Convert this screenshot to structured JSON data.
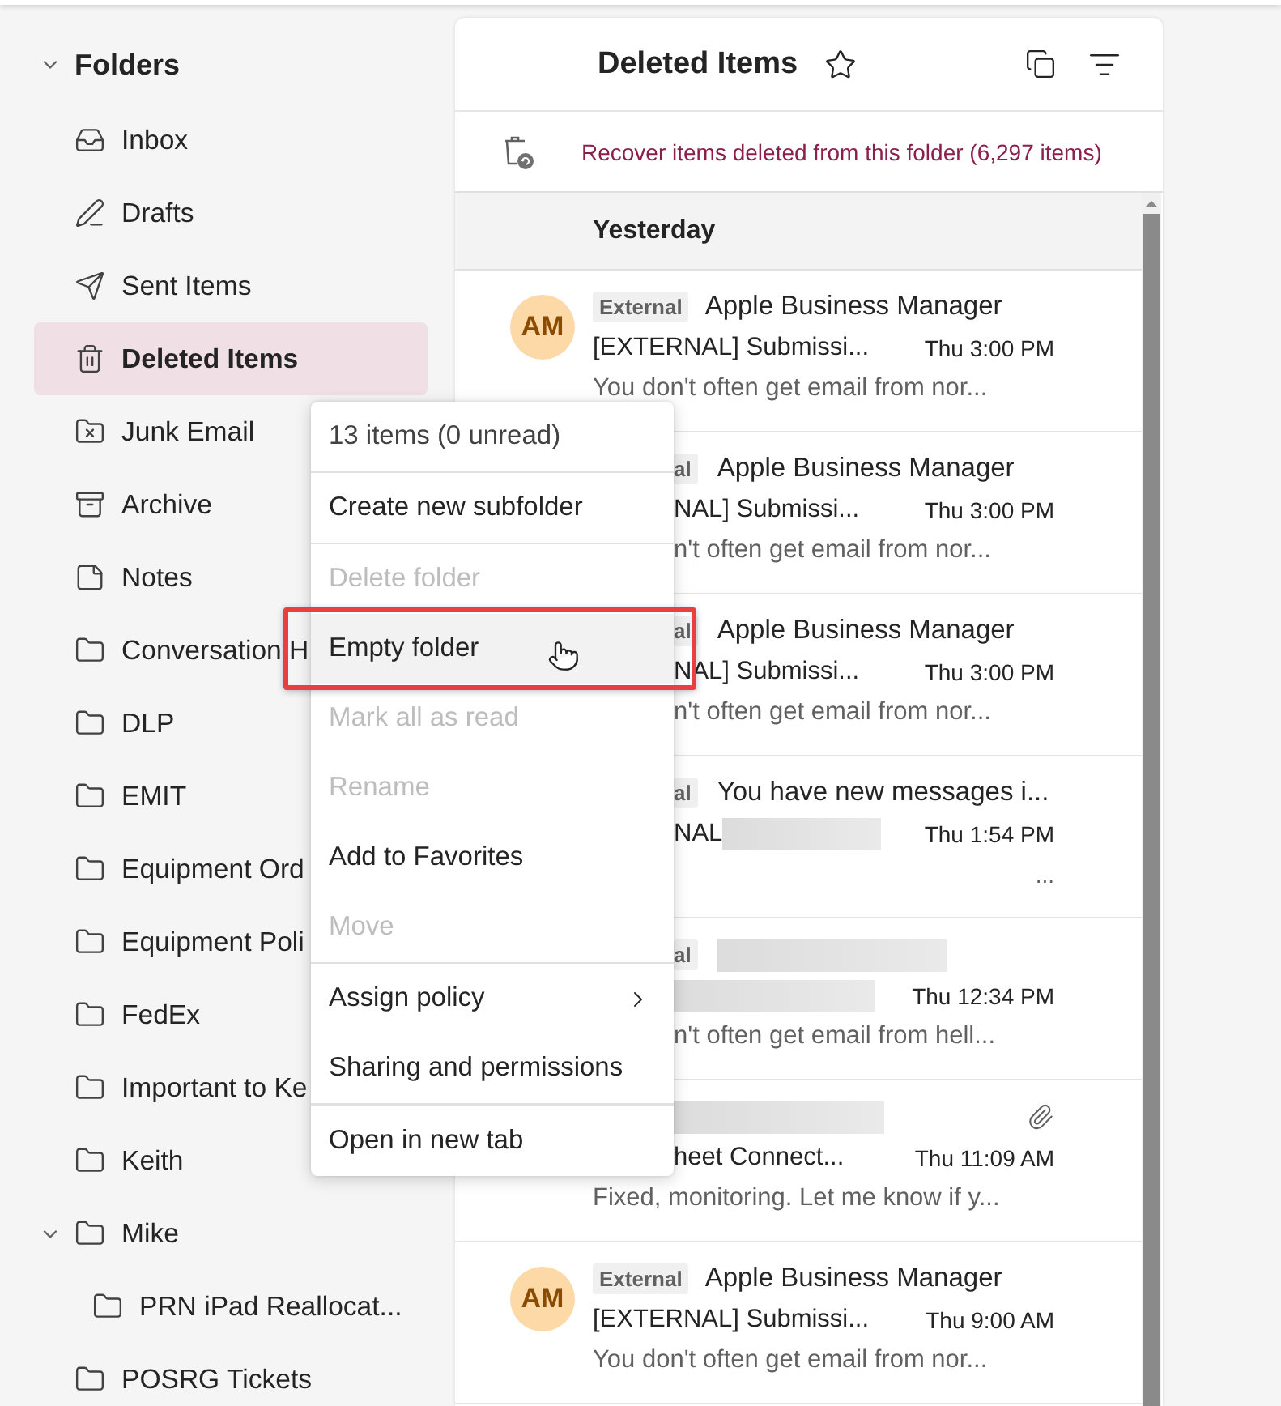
{
  "sidebar": {
    "header": {
      "label": "Folders",
      "expanded": true
    },
    "folders": [
      {
        "label": "Inbox",
        "kind": "inbox",
        "selected": false
      },
      {
        "label": "Drafts",
        "kind": "drafts",
        "selected": false
      },
      {
        "label": "Sent Items",
        "kind": "sent",
        "selected": false
      },
      {
        "label": "Deleted Items",
        "kind": "deleted",
        "selected": true
      },
      {
        "label": "Junk Email",
        "kind": "junk",
        "selected": false
      },
      {
        "label": "Archive",
        "kind": "archive",
        "selected": false
      },
      {
        "label": "Notes",
        "kind": "notes",
        "selected": false
      },
      {
        "label": "Conversation H",
        "kind": "folder",
        "selected": false
      },
      {
        "label": "DLP",
        "kind": "folder",
        "selected": false
      },
      {
        "label": "EMIT",
        "kind": "folder",
        "selected": false
      },
      {
        "label": "Equipment Ord",
        "kind": "folder",
        "selected": false
      },
      {
        "label": "Equipment Poli",
        "kind": "folder",
        "selected": false
      },
      {
        "label": "FedEx",
        "kind": "folder",
        "selected": false
      },
      {
        "label": "Important to Ke",
        "kind": "folder",
        "selected": false
      },
      {
        "label": "Keith",
        "kind": "folder",
        "selected": false
      },
      {
        "label": "Mike",
        "kind": "folder",
        "selected": false,
        "expanded": true,
        "children": [
          {
            "label": "PRN iPad Reallocat...",
            "kind": "folder",
            "selected": false
          }
        ]
      },
      {
        "label": "POSRG Tickets",
        "kind": "folder",
        "selected": false
      }
    ]
  },
  "message_list": {
    "title": "Deleted Items",
    "recover_link": "Recover items deleted from this folder (6,297 items)",
    "group": "Yesterday",
    "messages": [
      {
        "avatar": "AM",
        "tag": "External",
        "sender": "Apple Business Manager",
        "subject": "[EXTERNAL] Submissi...",
        "time": "Thu 3:00 PM",
        "preview": "You don't often get email from nor...",
        "covered": false,
        "preview_covered": false
      },
      {
        "tag": "al",
        "sender": "Apple Business Manager",
        "subject": "NAL] Submissi...",
        "time": "Thu 3:00 PM",
        "preview": "n't often get email from nor...",
        "covered": true,
        "preview_covered": true
      },
      {
        "tag": "al",
        "sender": "Apple Business Manager",
        "subject": "NAL] Submissi...",
        "time": "Thu 3:00 PM",
        "preview": "n't often get email from nor...",
        "covered": true,
        "preview_covered": true
      },
      {
        "tag": "al",
        "sender": "You have new messages i...",
        "subject": "NAL",
        "subject_redacted": true,
        "time": "Thu 1:54 PM",
        "trailing": "...",
        "covered": true,
        "preview_covered": true
      },
      {
        "tag": "al",
        "sender_redacted": true,
        "subject_redacted": true,
        "time": "Thu 12:34 PM",
        "preview": "n't often get email from hell...",
        "covered": true,
        "preview_covered": true
      },
      {
        "sender_redacted": true,
        "attachment": true,
        "subject": "heet Connect...",
        "time": "Thu 11:09 AM",
        "preview": "Fixed, monitoring. Let me know if y...",
        "covered": true,
        "preview_covered": false
      },
      {
        "avatar": "AM",
        "tag": "External",
        "sender": "Apple Business Manager",
        "subject": "[EXTERNAL] Submissi...",
        "time": "Thu 9:00 AM",
        "preview": "You don't often get email from nor...",
        "covered": false,
        "preview_covered": false
      }
    ]
  },
  "context_menu": {
    "groups": [
      [
        {
          "label": "13 items (0 unread)",
          "kind": "info",
          "disabled": false,
          "hovered": false
        }
      ],
      [
        {
          "label": "Create new subfolder",
          "kind": "item",
          "disabled": false,
          "hovered": false
        }
      ],
      [
        {
          "label": "Delete folder",
          "kind": "item",
          "disabled": true,
          "hovered": false
        },
        {
          "label": "Empty folder",
          "kind": "item",
          "disabled": false,
          "hovered": true
        },
        {
          "label": "Mark all as read",
          "kind": "item",
          "disabled": true,
          "hovered": false
        },
        {
          "label": "Rename",
          "kind": "item",
          "disabled": true,
          "hovered": false
        },
        {
          "label": "Add to Favorites",
          "kind": "item",
          "disabled": false,
          "hovered": false
        },
        {
          "label": "Move",
          "kind": "item",
          "disabled": true,
          "hovered": false
        }
      ],
      [
        {
          "label": "Assign policy",
          "kind": "submenu",
          "disabled": false,
          "hovered": false
        },
        {
          "label": "Sharing and permissions",
          "kind": "item",
          "disabled": false,
          "hovered": false
        }
      ],
      [
        {
          "label": "Open in new tab",
          "kind": "item",
          "disabled": false,
          "hovered": false
        }
      ]
    ]
  }
}
